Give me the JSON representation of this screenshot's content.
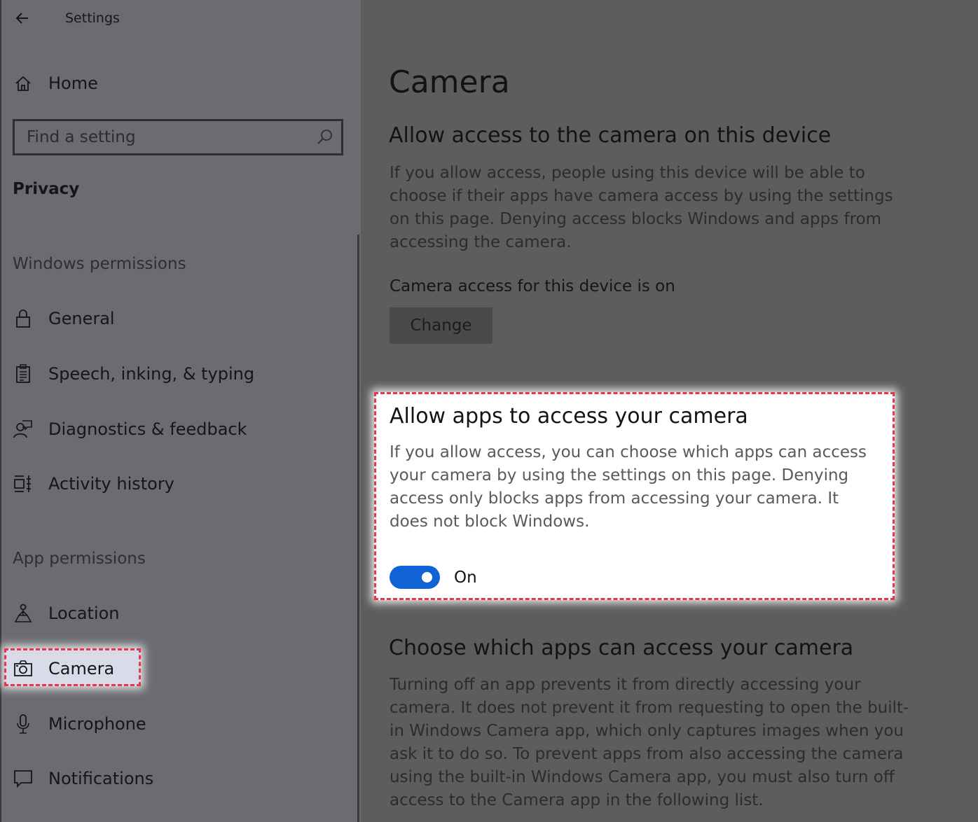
{
  "window": {
    "title": "Settings"
  },
  "sidebar": {
    "home_label": "Home",
    "search_placeholder": "Find a setting",
    "section_title": "Privacy",
    "windows_permissions": {
      "label": "Windows permissions",
      "items": [
        {
          "label": "General",
          "icon": "lock-icon"
        },
        {
          "label": "Speech, inking, & typing",
          "icon": "clipboard-icon"
        },
        {
          "label": "Diagnostics & feedback",
          "icon": "feedback-person-icon"
        },
        {
          "label": "Activity history",
          "icon": "timeline-icon"
        }
      ]
    },
    "app_permissions": {
      "label": "App permissions",
      "items": [
        {
          "label": "Location",
          "icon": "location-person-icon"
        },
        {
          "label": "Camera",
          "icon": "camera-icon",
          "selected": true
        },
        {
          "label": "Microphone",
          "icon": "microphone-icon"
        },
        {
          "label": "Notifications",
          "icon": "notification-icon"
        }
      ]
    }
  },
  "main": {
    "page_title": "Camera",
    "device_access": {
      "heading": "Allow access to the camera on this device",
      "description": "If you allow access, people using this device will be able to choose if their apps have camera access by using the settings on this page. Denying access blocks Windows and apps from accessing the camera.",
      "status": "Camera access for this device is on",
      "change_label": "Change"
    },
    "app_access": {
      "heading": "Allow apps to access your camera",
      "description": "If you allow access, you can choose which apps can access your camera by using the settings on this page. Denying access only blocks apps from accessing your camera. It does not block Windows.",
      "toggle_state": "On",
      "toggle_on": true
    },
    "choose_apps": {
      "heading": "Choose which apps can access your camera",
      "description": "Turning off an app prevents it from directly accessing your camera. It does not prevent it from requesting to open the built-in Windows Camera app, which only captures images when you ask it to do so. To prevent apps from also accessing the camera using the built-in Windows Camera app, you must also turn off access to the Camera app in the following list."
    }
  },
  "colors": {
    "highlight_border": "#e8344d",
    "toggle_on": "#0f63d4",
    "sidebar_bg": "#6b6c72",
    "main_bg": "#5d5d5d"
  }
}
